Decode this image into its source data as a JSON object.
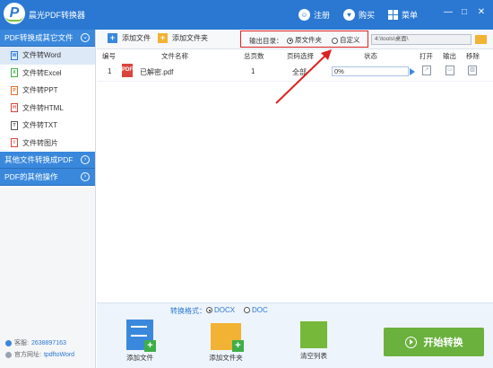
{
  "app": {
    "title": "晨光PDF转换器",
    "logo_letter": "P"
  },
  "titlebar": {
    "register": "注册",
    "buy": "购买",
    "menu": "菜单",
    "minimize": "—",
    "maximize": "□",
    "close": "✕",
    "register_icon": "user-icon",
    "buy_icon": "heart-icon",
    "menu_icon": "grid-icon"
  },
  "sidebar": {
    "sections": [
      {
        "label": "PDF转换成其它文件",
        "chevron": "⌄",
        "expanded": true
      },
      {
        "label": "其他文件转换成PDF",
        "chevron": "›",
        "expanded": false
      },
      {
        "label": "PDF的其他操作",
        "chevron": "›",
        "expanded": false
      }
    ],
    "items": [
      {
        "label": "文件转Word",
        "icon": "W",
        "color": "#2a78d2",
        "active": true
      },
      {
        "label": "文件转Excel",
        "icon": "X",
        "color": "#3fae49",
        "active": false
      },
      {
        "label": "文件转PPT",
        "icon": "P",
        "color": "#e36c2a",
        "active": false
      },
      {
        "label": "文件转HTML",
        "icon": "H",
        "color": "#d9453a",
        "active": false
      },
      {
        "label": "文件转TXT",
        "icon": "T",
        "color": "#555555",
        "active": false
      },
      {
        "label": "文件转图片",
        "icon": "I",
        "color": "#d9453a",
        "active": false
      }
    ],
    "footer": {
      "qq_label": "客服:",
      "qq_value": "2638897163",
      "site_label": "官方网址:",
      "site_value": "tpdftoWord"
    }
  },
  "toolbar": {
    "add_file": "添加文件",
    "add_folder": "添加文件夹",
    "output_label": "输出目录：",
    "opt_source": "原文件夹",
    "opt_custom": "自定义",
    "path": "4:\\tools\\桌面\\"
  },
  "table": {
    "headers": [
      "编号",
      "文件名称",
      "总页数",
      "页码选择",
      "状态",
      "打开",
      "输出",
      "移除"
    ],
    "rows": [
      {
        "index": "1",
        "name": "已解密.pdf",
        "pages": "1",
        "range": "全部",
        "progress": "0%"
      }
    ]
  },
  "format": {
    "label": "转换格式：",
    "opt1": "DOCX",
    "opt2": "DOC"
  },
  "bottom": {
    "add_file": "添加文件",
    "add_folder": "添加文件夹",
    "clear": "清空列表",
    "start": "开始转换"
  },
  "colors": {
    "accent": "#2a78d2",
    "highlight": "#dd2222",
    "start": "#6ab13e"
  }
}
